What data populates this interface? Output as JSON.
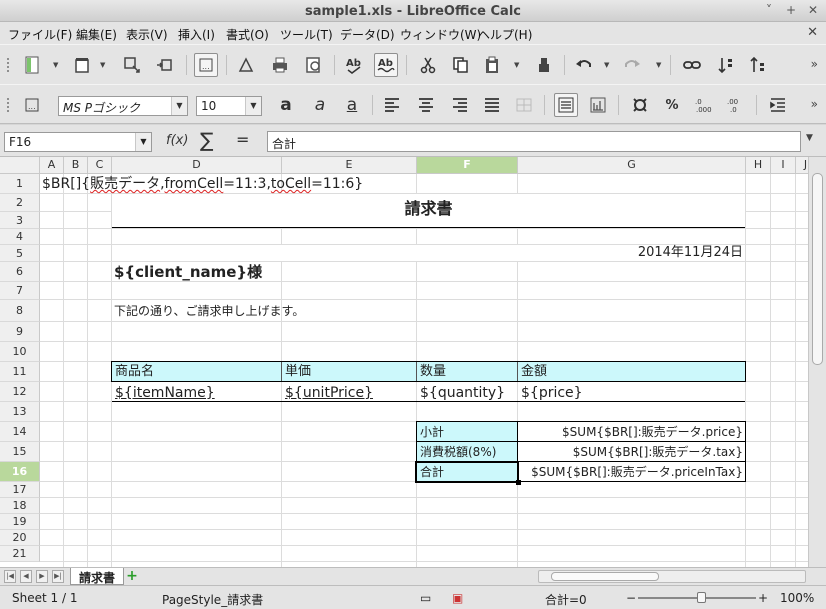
{
  "window": {
    "title": "sample1.xls - LibreOffice Calc",
    "controls": [
      "˅",
      "+",
      "✕"
    ]
  },
  "menu": {
    "items": [
      "ファイル(F)",
      "編集(E)",
      "表示(V)",
      "挿入(I)",
      "書式(O)",
      "ツール(T)",
      "データ(D)",
      "ウィンドウ(W)",
      "ヘルプ(H)"
    ],
    "close_doc": "✕"
  },
  "toolbar": {
    "standard": [
      "new-icon",
      "template-icon",
      "open-icon",
      "save-icon",
      "export-icon",
      "edit-mode-icon",
      "export-pdf-icon",
      "print-icon",
      "print-preview-icon",
      "spellcheck-icon",
      "autospell-icon",
      "cut-icon",
      "copy-icon",
      "paste-icon",
      "clone-format-icon",
      "undo-icon",
      "redo-icon",
      "hyperlink-icon",
      "sort-ascending-icon",
      "sort-descending-icon"
    ],
    "font_name": "MS Pゴシック",
    "font_size": "10",
    "more_label": "»"
  },
  "formula_bar": {
    "name_box": "F16",
    "fx_label": "f(x)",
    "sum_label": "∑",
    "equals_label": "=",
    "content": "合計"
  },
  "sheet": {
    "columns": [
      "A",
      "B",
      "C",
      "D",
      "E",
      "F",
      "G",
      "H",
      "I",
      "J"
    ],
    "rows": [
      "1",
      "2",
      "3",
      "4",
      "5",
      "6",
      "7",
      "8",
      "9",
      "10",
      "11",
      "12",
      "13",
      "14",
      "15",
      "16",
      "17",
      "18",
      "19",
      "20",
      "21"
    ],
    "selected_column": "F",
    "selected_row": "16",
    "cells": {
      "a1_prefix": "$BR[]{",
      "a1_sheetname": "販売データ",
      "a1_from_sep": ",",
      "a1_from": "fromCell",
      "a1_from_val": "=11:3,",
      "a1_to": "toCell",
      "a1_to_val": "=11:6}",
      "d2_title": "請求書",
      "g5_date": "2014年11月24日",
      "d6_client": "${client_name}様",
      "d8_message": "下記の通り、ご請求申し上げます。",
      "d11_header": "商品名",
      "e11_header": "単価",
      "f11_header": "数量",
      "g11_header": "金額",
      "d12_value": "${itemName}",
      "e12_value": "${unitPrice}",
      "f12_value": "${quantity}",
      "g12_value": "${price}",
      "f14_label": "小計",
      "g14_value": "$SUM{$BR[]:販売データ.price}",
      "f15_label": "消費税額(8%)",
      "g15_value": "$SUM{$BR[]:販売データ.tax}",
      "f16_label": "合計",
      "g16_value": "$SUM{$BR[]:販売データ.priceInTax}"
    }
  },
  "tabs": {
    "sheet_name": "請求書",
    "add_label": "+"
  },
  "status": {
    "sheet": "Sheet 1 / 1",
    "page_style": "PageStyle_請求書",
    "sum": "合計=0",
    "zoom_minus": "−",
    "zoom_plus": "+",
    "zoom": "100%",
    "zoom_fraction": 0.5
  },
  "colors": {
    "header_fill": "#ccf8fb",
    "selection_header": "#b9d89c"
  }
}
